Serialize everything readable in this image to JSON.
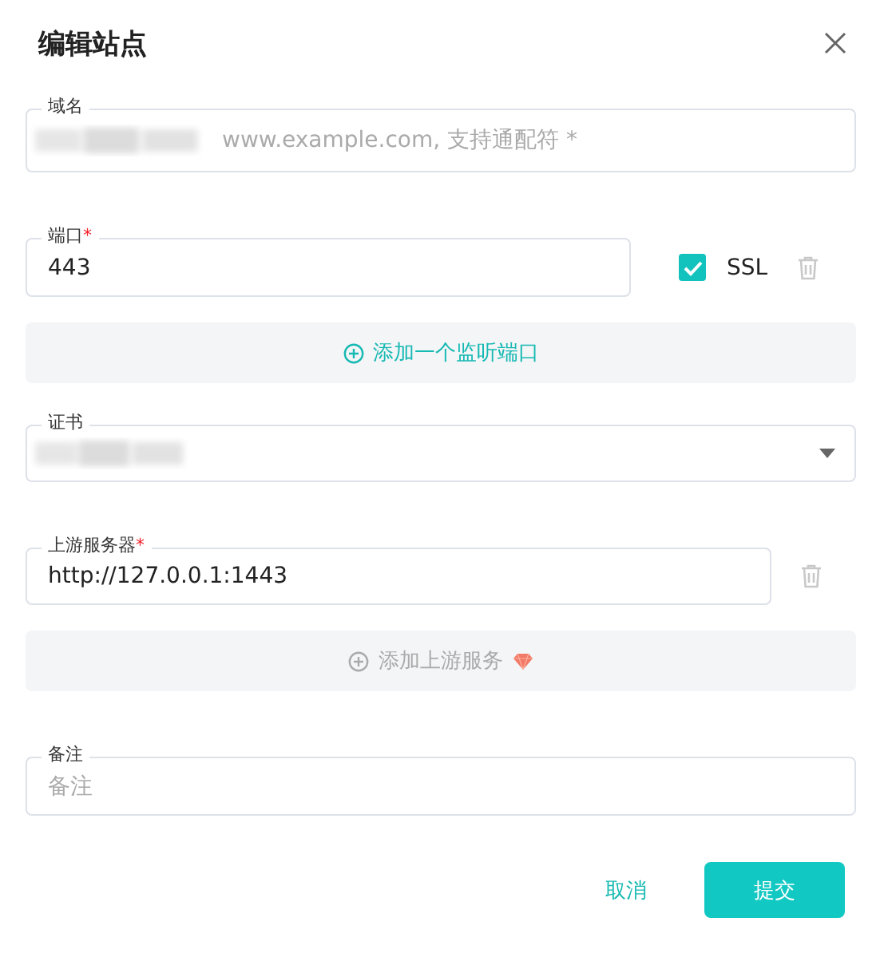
{
  "dialog": {
    "title": "编辑站点"
  },
  "domain": {
    "label": "域名",
    "placeholder": "www.example.com, 支持通配符 *",
    "redacted": true
  },
  "port": {
    "label": "端口",
    "required_mark": "*",
    "value": "443",
    "ssl": {
      "label": "SSL",
      "checked": true
    }
  },
  "add_port_button": {
    "label": "添加一个监听端口",
    "disabled": false
  },
  "certificate": {
    "label": "证书",
    "redacted": true
  },
  "upstream": {
    "label": "上游服务器",
    "required_mark": "*",
    "value": "http://127.0.0.1:1443"
  },
  "add_upstream_button": {
    "label": "添加上游服务",
    "disabled": true,
    "premium": true
  },
  "remark": {
    "label": "备注",
    "placeholder": "备注"
  },
  "buttons": [
    {
      "label": "取消",
      "kind": "text"
    },
    {
      "label": "提交",
      "kind": "primary"
    }
  ]
}
